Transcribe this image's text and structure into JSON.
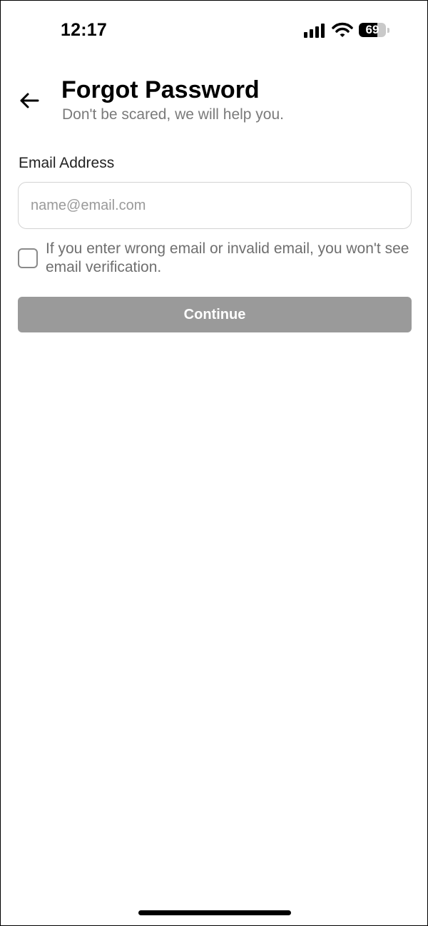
{
  "status_bar": {
    "time": "12:17",
    "battery_level": "69",
    "icons": [
      "cellular-signal-icon",
      "wifi-icon",
      "battery-icon"
    ]
  },
  "header": {
    "back_icon": "arrow-left-icon",
    "title": "Forgot Password",
    "subtitle": "Don't be scared, we will help you."
  },
  "form": {
    "email_label": "Email Address",
    "email_value": "",
    "email_placeholder": "name@email.com",
    "checkbox_checked": false,
    "checkbox_text": "If you enter wrong email or invalid email, you won't see email verification.",
    "continue_label": "Continue"
  },
  "colors": {
    "button_disabled": "#9a9a9a",
    "subtitle_text": "#7a7a7a",
    "input_border": "#d3d3d3"
  }
}
